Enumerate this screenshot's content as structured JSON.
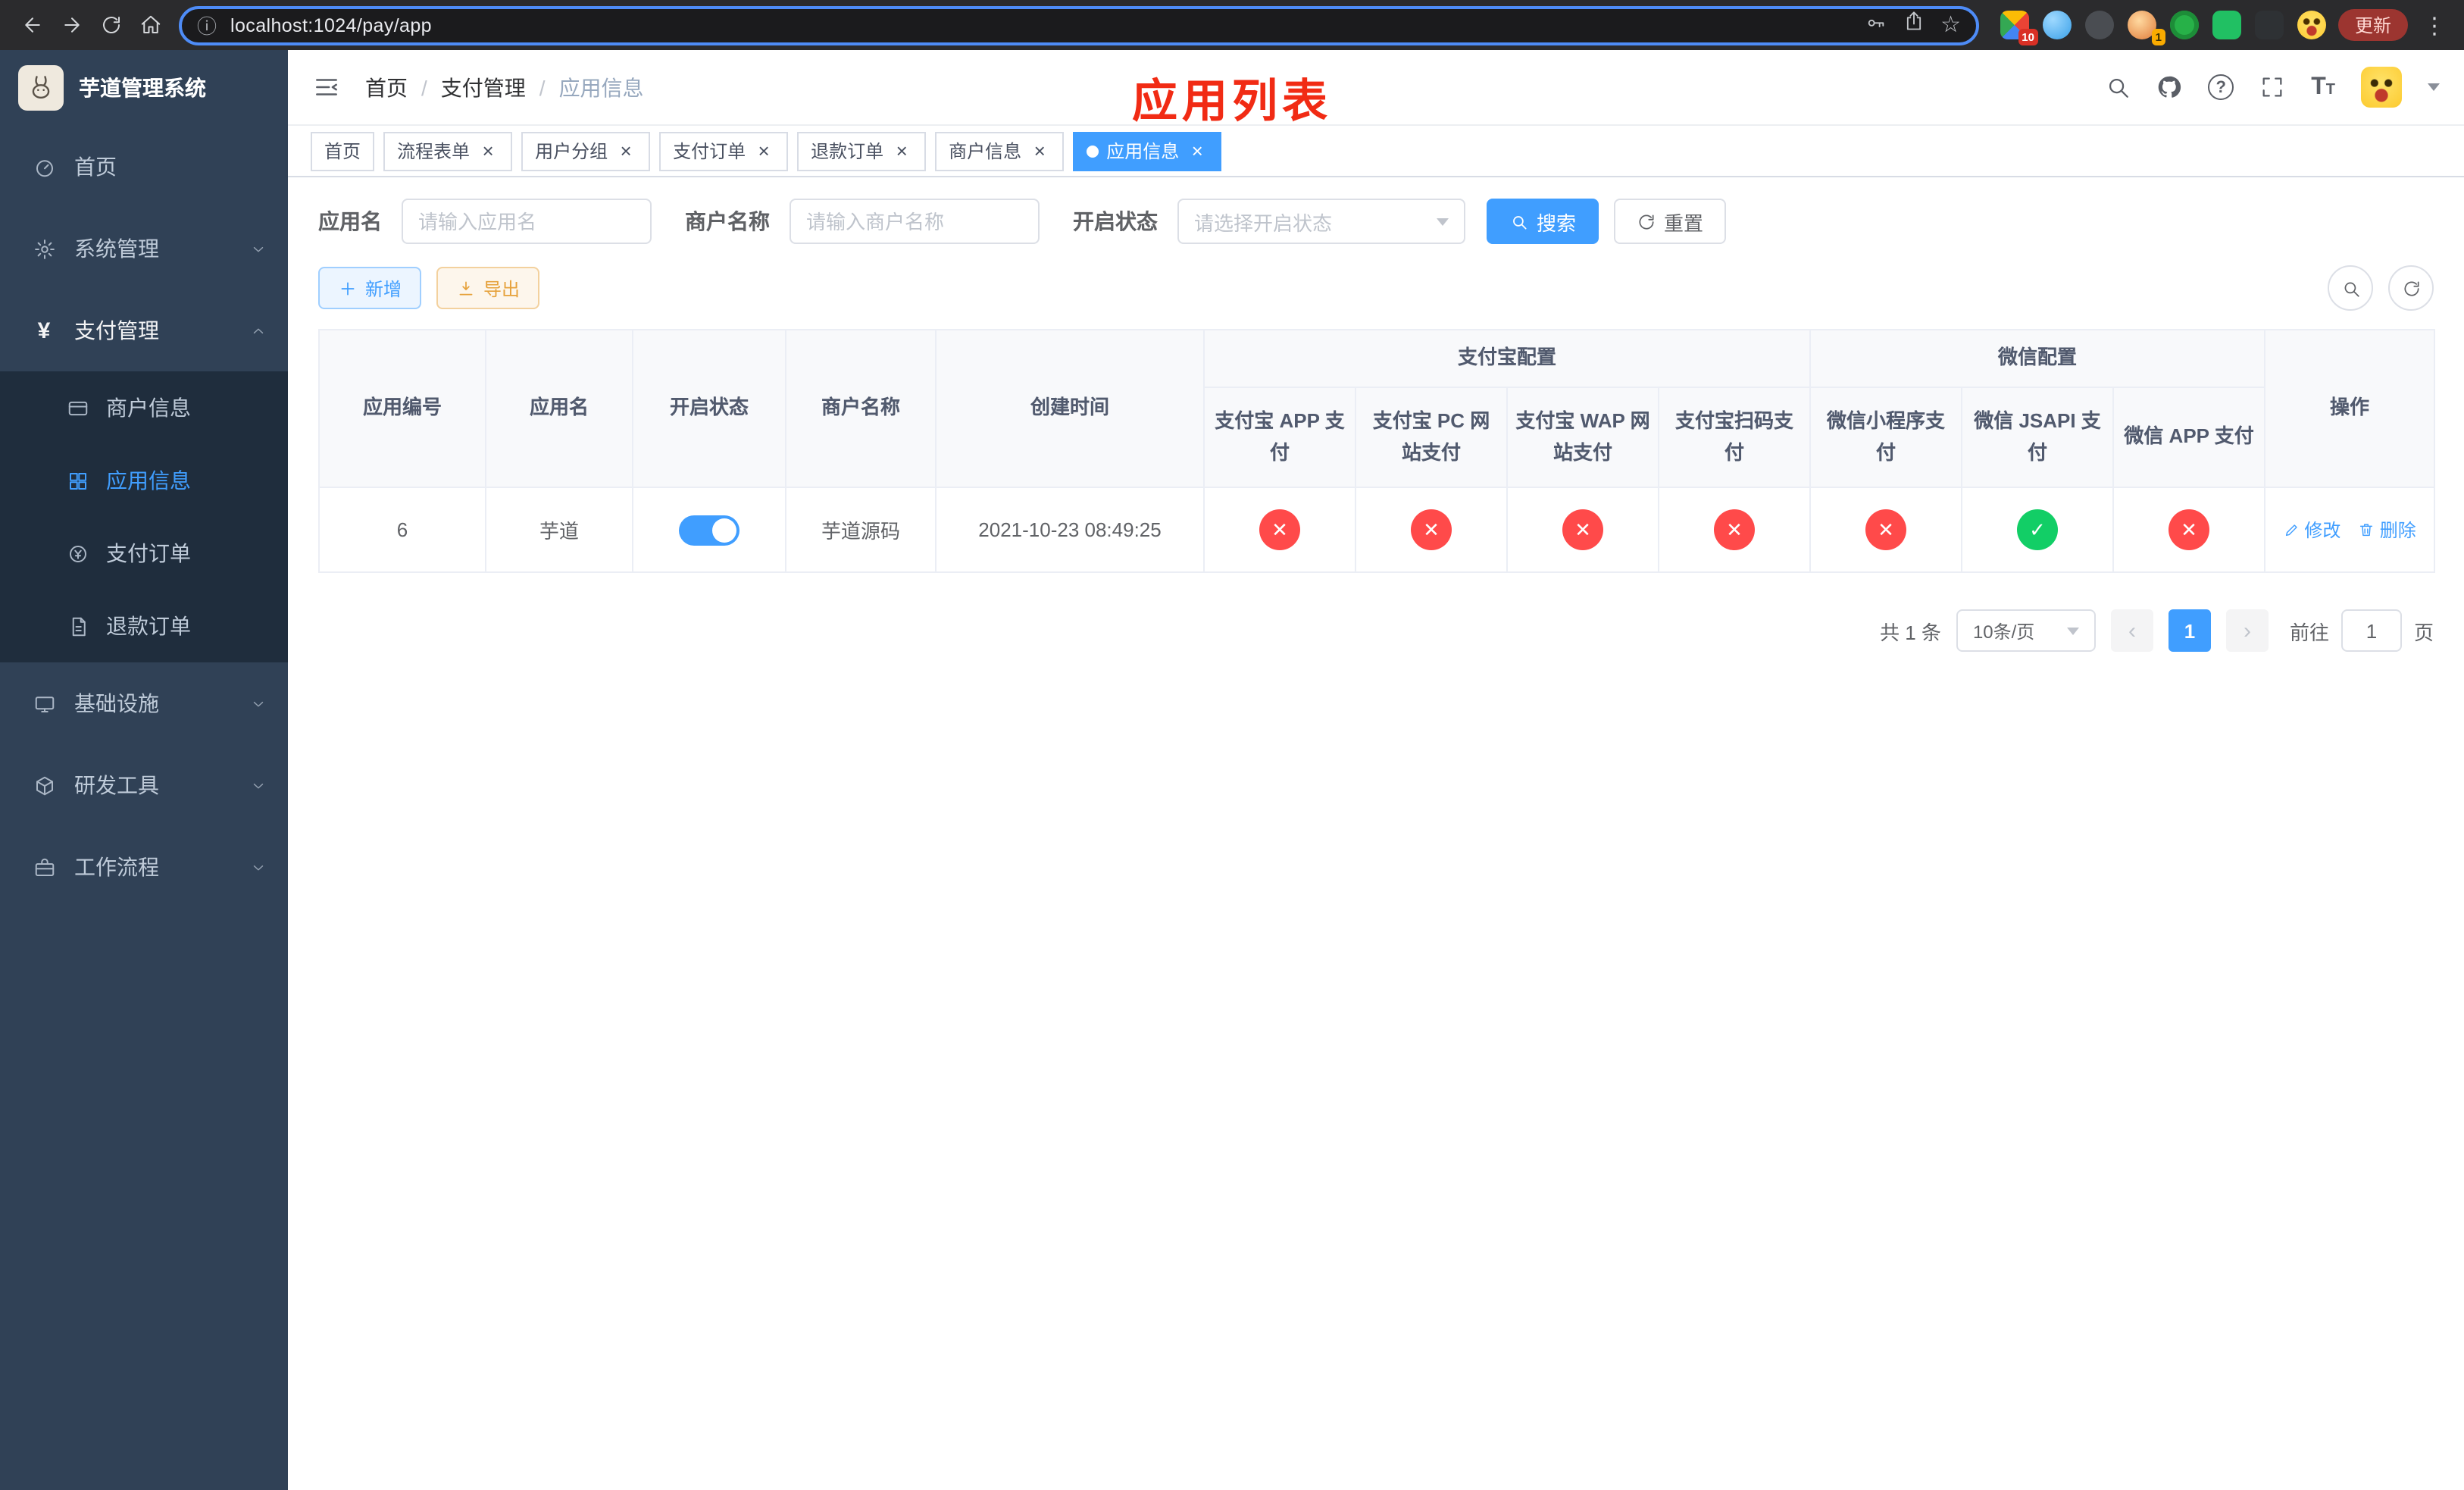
{
  "browser": {
    "url": "localhost:1024/pay/app",
    "update_label": "更新",
    "ext_badges": [
      "10",
      "1"
    ]
  },
  "icons": {
    "info": "ⓘ",
    "star": "☆",
    "more": "⋮",
    "close": "×",
    "prev": "‹",
    "next": "›",
    "yen": "¥",
    "help": "?",
    "font_size_large": "T",
    "font_size_small": "T",
    "breadcrumb_sep": "/"
  },
  "colors": {
    "accent": "#409eff",
    "success": "#12ce66",
    "danger": "#ff4a4a",
    "warning": "#e6a23c",
    "sidebar_bg": "#304156",
    "annotation_red": "#f12b14"
  },
  "sidebar": {
    "title": "芋道管理系统",
    "items": [
      {
        "label": "首页"
      },
      {
        "label": "系统管理"
      },
      {
        "label": "支付管理",
        "children": [
          {
            "label": "商户信息"
          },
          {
            "label": "应用信息"
          },
          {
            "label": "支付订单"
          },
          {
            "label": "退款订单"
          }
        ]
      },
      {
        "label": "基础设施"
      },
      {
        "label": "研发工具"
      },
      {
        "label": "工作流程"
      }
    ]
  },
  "header": {
    "breadcrumb": [
      "首页",
      "支付管理",
      "应用信息"
    ],
    "annotation": "应用列表"
  },
  "tabs": [
    {
      "label": "首页"
    },
    {
      "label": "流程表单"
    },
    {
      "label": "用户分组"
    },
    {
      "label": "支付订单"
    },
    {
      "label": "退款订单"
    },
    {
      "label": "商户信息"
    },
    {
      "label": "应用信息"
    }
  ],
  "filters": {
    "app_name_label": "应用名",
    "app_name_placeholder": "请输入应用名",
    "merchant_label": "商户名称",
    "merchant_placeholder": "请输入商户名称",
    "status_label": "开启状态",
    "status_placeholder": "请选择开启状态",
    "search_label": "搜索",
    "reset_label": "重置"
  },
  "toolbar": {
    "add_label": "新增",
    "export_label": "导出"
  },
  "table": {
    "columns": {
      "id": "应用编号",
      "name": "应用名",
      "status": "开启状态",
      "merchant": "商户名称",
      "created": "创建时间",
      "alipay_group": "支付宝配置",
      "alipay": [
        "支付宝 APP 支付",
        "支付宝 PC 网站支付",
        "支付宝 WAP 网站支付",
        "支付宝扫码支付"
      ],
      "wechat_group": "微信配置",
      "wechat": [
        "微信小程序支付",
        "微信 JSAPI 支付",
        "微信 APP 支付"
      ],
      "ops": "操作"
    },
    "rows": [
      {
        "id": "6",
        "name": "芋道",
        "status": "on",
        "merchant": "芋道源码",
        "created": "2021-10-23 08:49:25",
        "configs": [
          "disabled",
          "disabled",
          "disabled",
          "disabled",
          "disabled",
          "enabled",
          "disabled"
        ],
        "edit": "修改",
        "delete": "删除"
      }
    ]
  },
  "pagination": {
    "total": "共 1 条",
    "page_size": "10条/页",
    "page": "1",
    "goto_label": "前往",
    "goto_value": "1",
    "goto_unit": "页"
  }
}
